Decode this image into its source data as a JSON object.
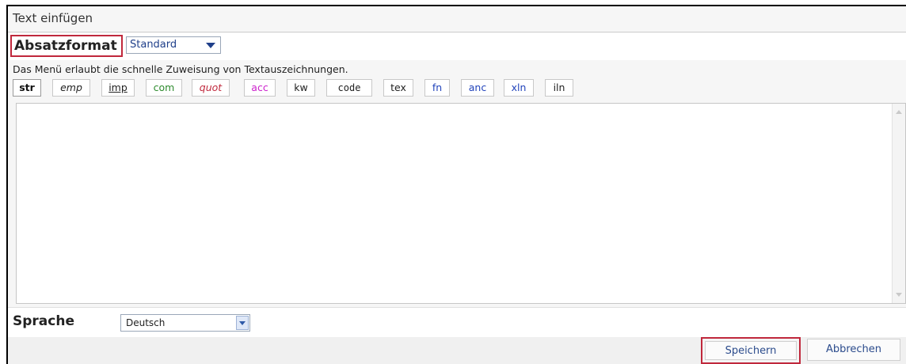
{
  "dialog": {
    "title": "Text einfügen"
  },
  "format": {
    "label": "Absatzformat",
    "selected": "Standard"
  },
  "info_text": "Das Menü erlaubt die schnelle Zuweisung von Textauszeichnungen.",
  "tags": [
    {
      "label": "str",
      "color": "#111111"
    },
    {
      "label": "emp",
      "color": "#222222"
    },
    {
      "label": "imp",
      "color": "#222222"
    },
    {
      "label": "com",
      "color": "#2e8b2e"
    },
    {
      "label": "quot",
      "color": "#c0283c"
    },
    {
      "label": "acc",
      "color": "#cc22cc"
    },
    {
      "label": "kw",
      "color": "#222222"
    },
    {
      "label": "code",
      "color": "#222222"
    },
    {
      "label": "tex",
      "color": "#222222"
    },
    {
      "label": "fn",
      "color": "#2244bb"
    },
    {
      "label": "anc",
      "color": "#2244bb"
    },
    {
      "label": "xln",
      "color": "#2244bb"
    },
    {
      "label": "iln",
      "color": "#222222"
    }
  ],
  "editor": {
    "content": ""
  },
  "language": {
    "label": "Sprache",
    "selected": "Deutsch"
  },
  "buttons": {
    "save": "Speichern",
    "cancel": "Abbrechen"
  },
  "colors": {
    "highlight": "#c0283c",
    "link_blue": "#2b4b8c"
  }
}
